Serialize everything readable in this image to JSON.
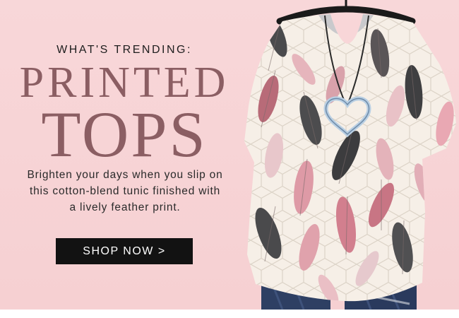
{
  "promo": {
    "eyebrow": "WHAT'S TRENDING:",
    "headline_line1": "PRINTED",
    "headline_line2": "TOPS",
    "body": "Brighten your days when you slip on this cotton-blend tunic finished with a lively feather print.",
    "cta_label": "SHOP NOW >"
  },
  "product_image": {
    "subject": "feather print tunic on hanger with heart pendant necklace and jeans"
  },
  "colors": {
    "background": "#f8d7d9",
    "headline": "#8b5e63",
    "button": "#121212",
    "button_text": "#ffffff"
  }
}
